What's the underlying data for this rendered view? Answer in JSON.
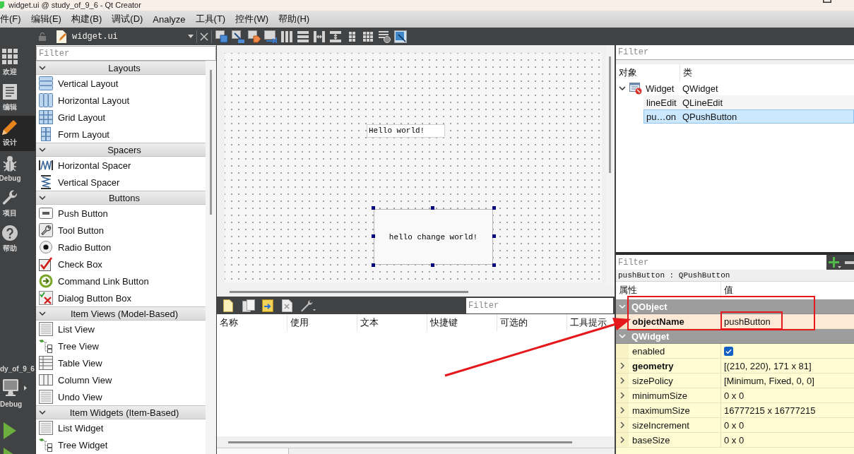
{
  "window": {
    "title": "widget.ui @ study_of_9_6 - Qt Creator"
  },
  "menu_bar": [
    "件(F)",
    "编辑(E)",
    "构建(B)",
    "调试(D)",
    "Analyze",
    "工具(T)",
    "控件(W)",
    "帮助(H)"
  ],
  "editor_toolbar": {
    "file_name": "widget.ui"
  },
  "mode_bar": {
    "modes": [
      {
        "label": "欢迎",
        "kind": "welcome",
        "selected": false
      },
      {
        "label": "编辑",
        "kind": "edit",
        "selected": false
      },
      {
        "label": "设计",
        "kind": "design",
        "selected": true
      },
      {
        "label": "Debug",
        "kind": "debug",
        "selected": false
      },
      {
        "label": "项目",
        "kind": "projects",
        "selected": false
      },
      {
        "label": "帮助",
        "kind": "help",
        "selected": false
      }
    ],
    "project": "dy_of_9_6",
    "build_config": "Debug"
  },
  "widget_box": {
    "filter": {
      "placeholder": "Filter"
    },
    "categories": [
      {
        "title": "Layouts",
        "expanded": true,
        "items": [
          {
            "label": "Vertical Layout",
            "kind": "vertical-layout"
          },
          {
            "label": "Horizontal Layout",
            "kind": "horizontal-layout"
          },
          {
            "label": "Grid Layout",
            "kind": "grid-layout"
          },
          {
            "label": "Form Layout",
            "kind": "form-layout"
          }
        ]
      },
      {
        "title": "Spacers",
        "expanded": true,
        "items": [
          {
            "label": "Horizontal Spacer",
            "kind": "horizontal-spacer"
          },
          {
            "label": "Vertical Spacer",
            "kind": "vertical-spacer"
          }
        ]
      },
      {
        "title": "Buttons",
        "expanded": true,
        "items": [
          {
            "label": "Push Button",
            "kind": "push-button"
          },
          {
            "label": "Tool Button",
            "kind": "tool-button"
          },
          {
            "label": "Radio Button",
            "kind": "radio-button"
          },
          {
            "label": "Check Box",
            "kind": "check-box"
          },
          {
            "label": "Command Link Button",
            "kind": "command-link-button"
          },
          {
            "label": "Dialog Button Box",
            "kind": "dialog-button-box"
          }
        ]
      },
      {
        "title": "Item Views (Model-Based)",
        "expanded": true,
        "items": [
          {
            "label": "List View",
            "kind": "list"
          },
          {
            "label": "Tree View",
            "kind": "tree"
          },
          {
            "label": "Table View",
            "kind": "table"
          },
          {
            "label": "Column View",
            "kind": "column"
          },
          {
            "label": "Undo View",
            "kind": "list"
          }
        ]
      },
      {
        "title": "Item Widgets (Item-Based)",
        "expanded": true,
        "items": [
          {
            "label": "List Widget",
            "kind": "list"
          },
          {
            "label": "Tree Widget",
            "kind": "tree"
          }
        ]
      }
    ]
  },
  "form_editor": {
    "line_edit": {
      "value": "Hello world!"
    },
    "push_button": {
      "label": "hello change world!",
      "selected": true
    }
  },
  "action_editor": {
    "filter": {
      "placeholder": "Filter"
    },
    "columns": [
      "名称",
      "使用",
      "文本",
      "快捷键",
      "可选的",
      "工具提示"
    ]
  },
  "object_inspector": {
    "filter": {
      "placeholder": "Filter"
    },
    "columns": [
      "对象",
      "类"
    ],
    "tree": [
      {
        "object": "Widget",
        "class": "QWidget",
        "expanded": true,
        "selected": false,
        "children": [
          {
            "object": "lineEdit",
            "class": "QLineEdit",
            "selected": false
          },
          {
            "object": "pu…on",
            "class": "QPushButton",
            "selected": true
          }
        ]
      }
    ]
  },
  "property_editor": {
    "filter": {
      "placeholder": "Filter"
    },
    "subject": "pushButton : QPushButton",
    "columns": [
      "属性",
      "值"
    ],
    "groups": [
      {
        "name": "QObject",
        "expanded": true,
        "color": "#fde9d6",
        "properties": [
          {
            "name": "objectName",
            "kind": "text",
            "value": "pushButton",
            "changed": true,
            "expandable": false
          }
        ]
      },
      {
        "name": "QWidget",
        "expanded": true,
        "color": "#fffcd4",
        "properties": [
          {
            "name": "enabled",
            "kind": "checkbox",
            "checked": true,
            "changed": false,
            "expandable": false
          },
          {
            "name": "geometry",
            "kind": "text",
            "value": "[(210, 220), 171 x 81]",
            "changed": true,
            "expandable": true
          },
          {
            "name": "sizePolicy",
            "kind": "text",
            "value": "[Minimum, Fixed, 0, 0]",
            "changed": false,
            "expandable": true
          },
          {
            "name": "minimumSize",
            "kind": "text",
            "value": "0 x 0",
            "changed": false,
            "expandable": true
          },
          {
            "name": "maximumSize",
            "kind": "text",
            "value": "16777215 x 16777215",
            "changed": false,
            "expandable": true
          },
          {
            "name": "sizeIncrement",
            "kind": "text",
            "value": "0 x 0",
            "changed": false,
            "expandable": true
          },
          {
            "name": "baseSize",
            "kind": "text",
            "value": "0 x 0",
            "changed": false,
            "expandable": true
          }
        ]
      }
    ]
  }
}
